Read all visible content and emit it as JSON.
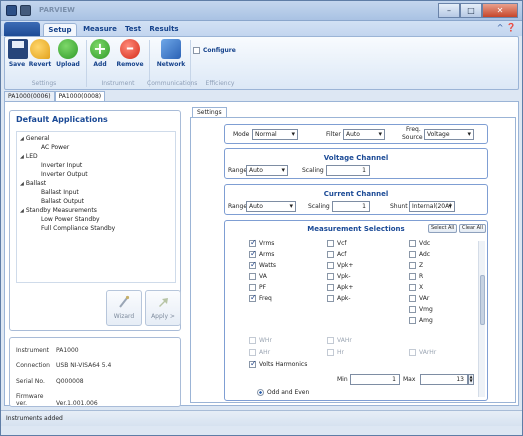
{
  "window": {
    "title": "PARVIEW"
  },
  "ribbon": {
    "tabs": [
      {
        "label": "Setup"
      },
      {
        "label": "Measure"
      },
      {
        "label": "Test"
      },
      {
        "label": "Results"
      }
    ],
    "buttons": {
      "save": "Save",
      "revert": "Revert",
      "upload": "Upload",
      "add": "Add",
      "remove": "Remove",
      "network": "Network"
    },
    "configure_label": "Configure",
    "groups": [
      "Settings",
      "Instrument",
      "Communications",
      "Efficiency"
    ]
  },
  "instrument_tabs": [
    "PA1000(0006)",
    "PA1000(0008)"
  ],
  "left": {
    "apps_title": "Default Applications",
    "tree": [
      {
        "label": "General",
        "arrow": "◢"
      },
      {
        "label": "AC Power"
      },
      {
        "label": "LED",
        "arrow": "◢"
      },
      {
        "label": "Inverter Input"
      },
      {
        "label": "Inverter Output"
      },
      {
        "label": "Ballast",
        "arrow": "◢"
      },
      {
        "label": "Ballast Input"
      },
      {
        "label": "Ballast Output"
      },
      {
        "label": "Standby Measurements",
        "arrow": "◢"
      },
      {
        "label": "Low Power Standby"
      },
      {
        "label": "Full Compliance Standby"
      }
    ],
    "wizard_label": "Wizard",
    "apply_label": "Apply >",
    "info": [
      {
        "key": "Instrument",
        "value": "PA1000"
      },
      {
        "key": "Connection",
        "value": "USB NI-VISA64 5.4"
      },
      {
        "key": "Serial No.",
        "value": "Q000008"
      },
      {
        "key": "Firmware ver.",
        "value": "Ver.1.001.006"
      }
    ]
  },
  "settings": {
    "tab_label": "Settings",
    "mode_label": "Mode",
    "mode_value": "Normal",
    "filter_label": "Filter",
    "filter_value": "Auto",
    "freq_source_label_1": "Freq.",
    "freq_source_label_2": "Source",
    "freq_source_value": "Voltage",
    "voltage": {
      "title": "Voltage Channel",
      "range_label": "Range",
      "range_value": "Auto",
      "scaling_label": "Scaling",
      "scaling_value": "1"
    },
    "current": {
      "title": "Current Channel",
      "range_label": "Range",
      "range_value": "Auto",
      "scaling_label": "Scaling",
      "scaling_value": "1",
      "shunt_label": "Shunt",
      "shunt_value": "Internal(20A)"
    },
    "measurement": {
      "title": "Measurement Selections",
      "select_all": "Select All",
      "clear_all": "Clear All",
      "col1": [
        {
          "label": "Vrms",
          "checked": true
        },
        {
          "label": "Arms",
          "checked": true
        },
        {
          "label": "Watts",
          "checked": true
        },
        {
          "label": "VA",
          "checked": false
        },
        {
          "label": "PF",
          "checked": false
        },
        {
          "label": "Freq",
          "checked": true
        }
      ],
      "col2": [
        {
          "label": "Vcf",
          "checked": false
        },
        {
          "label": "Acf",
          "checked": false
        },
        {
          "label": "Vpk+",
          "checked": false
        },
        {
          "label": "Vpk-",
          "checked": false
        },
        {
          "label": "Apk+",
          "checked": false
        },
        {
          "label": "Apk-",
          "checked": false
        }
      ],
      "col3": [
        {
          "label": "Vdc",
          "checked": false
        },
        {
          "label": "Adc",
          "checked": false
        },
        {
          "label": "Z",
          "checked": false
        },
        {
          "label": "R",
          "checked": false
        },
        {
          "label": "X",
          "checked": false
        },
        {
          "label": "VAr",
          "checked": false
        },
        {
          "label": "Vmg",
          "checked": false
        },
        {
          "label": "Amg",
          "checked": false
        }
      ],
      "disabled": {
        "whr": "WHr",
        "vahr": "VAHr",
        "ahr": "AHr",
        "hr": "Hr",
        "varhr": "VArHr"
      },
      "volts_harmonics": {
        "label": "Volts Harmonics",
        "checked": true
      },
      "min_label": "Min",
      "min_value": "1",
      "max_label": "Max",
      "max_value": "13",
      "odd_even_label": "Odd and Even"
    }
  },
  "status": {
    "text": "Instruments added"
  }
}
